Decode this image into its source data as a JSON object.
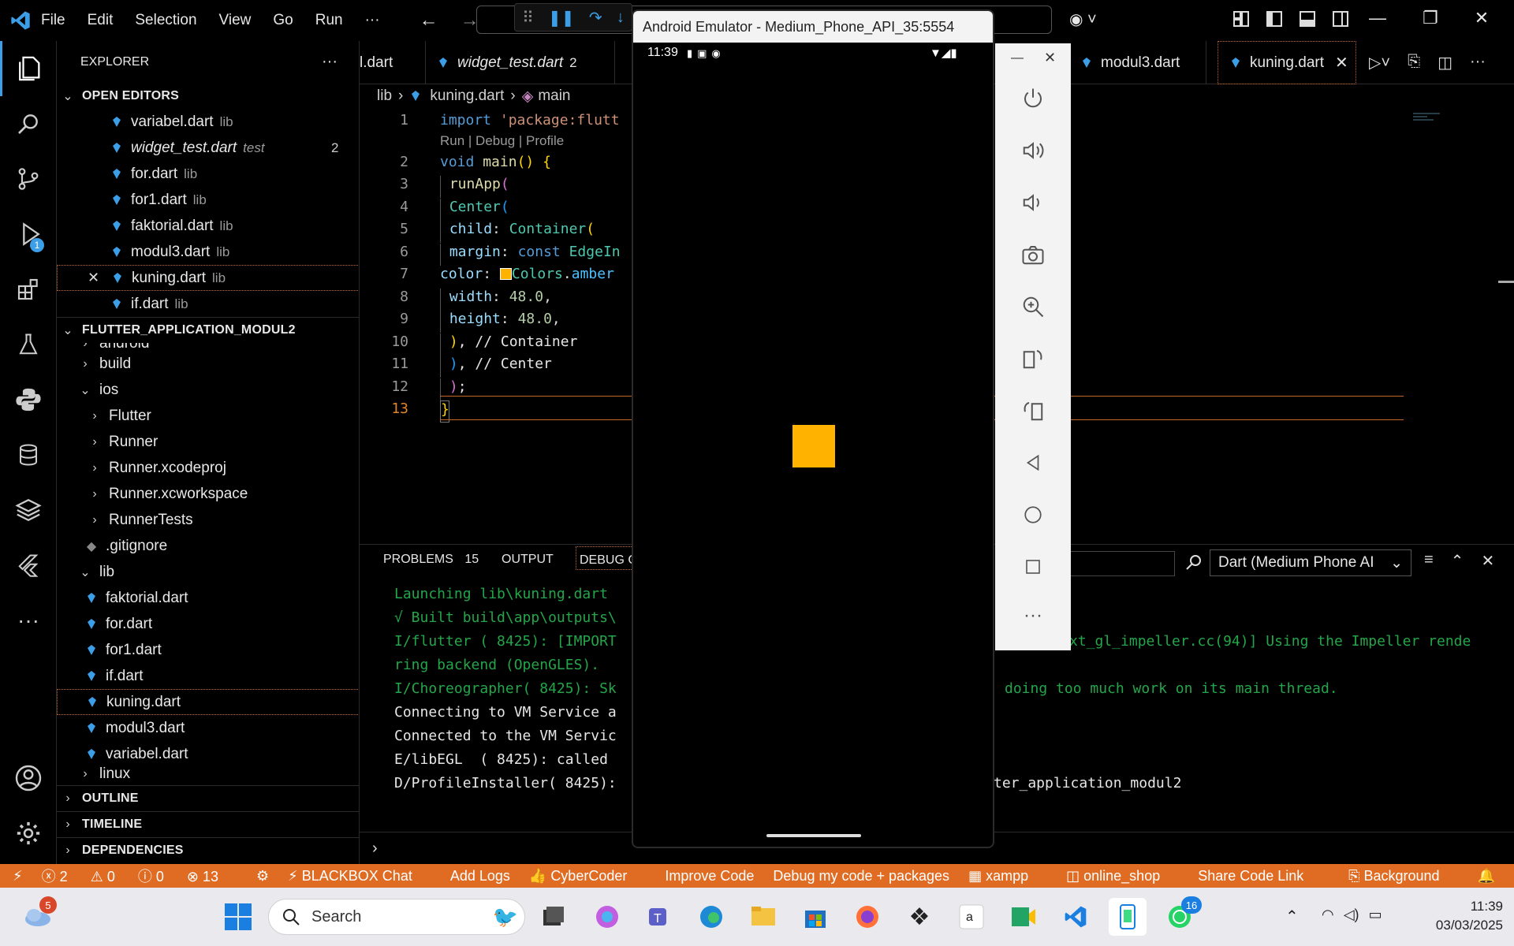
{
  "menu": [
    "File",
    "Edit",
    "Selection",
    "View",
    "Go",
    "Run",
    "···"
  ],
  "emulator": {
    "title": "Android Emulator - Medium_Phone_API_35:5554",
    "time": "11:39",
    "square_color": "#ffb300"
  },
  "explorer": {
    "title": "EXPLORER",
    "open_editors_label": "OPEN EDITORS",
    "open_editors": [
      {
        "name": "variabel.dart",
        "desc": "lib"
      },
      {
        "name": "widget_test.dart",
        "desc": "test",
        "badge": "2"
      },
      {
        "name": "for.dart",
        "desc": "lib"
      },
      {
        "name": "for1.dart",
        "desc": "lib"
      },
      {
        "name": "faktorial.dart",
        "desc": "lib"
      },
      {
        "name": "modul3.dart",
        "desc": "lib"
      },
      {
        "name": "kuning.dart",
        "desc": "lib"
      },
      {
        "name": "if.dart",
        "desc": "lib"
      }
    ],
    "project_label": "FLUTTER_APPLICATION_MODUL2",
    "tree": [
      "android",
      "build",
      "ios",
      "Flutter",
      "Runner",
      "Runner.xcodeproj",
      "Runner.xcworkspace",
      "RunnerTests",
      ".gitignore",
      "lib",
      "faktorial.dart",
      "for.dart",
      "for1.dart",
      "if.dart",
      "kuning.dart",
      "modul3.dart",
      "variabel.dart",
      "linux"
    ],
    "outline": "OUTLINE",
    "timeline": "TIMELINE",
    "dependencies": "DEPENDENCIES"
  },
  "tabs": [
    {
      "label": "l.dart"
    },
    {
      "label": "widget_test.dart",
      "badge": "2"
    },
    {
      "label": "modul3.dart"
    },
    {
      "label": "kuning.dart"
    }
  ],
  "breadcrumb": [
    "lib",
    "kuning.dart",
    "main"
  ],
  "codelens": "Run | Debug | Profile",
  "code": [
    {
      "n": "1",
      "t": "import 'package:flutt"
    },
    {
      "n": "2",
      "t": "void main() {"
    },
    {
      "n": "3",
      "t": " runApp("
    },
    {
      "n": "4",
      "t": " Center("
    },
    {
      "n": "5",
      "t": " child: Container("
    },
    {
      "n": "6",
      "t": " margin: const EdgeIn"
    },
    {
      "n": "7",
      "t": "color: Colors.amber"
    },
    {
      "n": "8",
      "t": " width: 48.0,"
    },
    {
      "n": "9",
      "t": " height: 48.0,"
    },
    {
      "n": "10",
      "t": " ), // Container"
    },
    {
      "n": "11",
      "t": " ), // Center"
    },
    {
      "n": "12",
      "t": " );"
    },
    {
      "n": "13",
      "t": "}"
    }
  ],
  "panel": {
    "problems": "PROBLEMS",
    "problems_count": "15",
    "output": "OUTPUT",
    "debug": "DEBUG C",
    "dropdown": "Dart (Medium Phone AI",
    "lines": [
      "Launching lib\\kuning.dart",
      "√ Built build\\app\\outputs\\",
      "I/flutter ( 8425): [IMPORT",
      "ring backend (OpenGLES).",
      "I/Choreographer( 8425): Sk",
      "Connecting to VM Service a",
      "Connected to the VM Servic",
      "E/libEGL  ( 8425): called",
      "D/ProfileInstaller( 8425):"
    ],
    "right_lines": [
      "xt_gl_impeller.cc(94)] Using the Impeller rende",
      "doing too much work on its main thread.",
      "ter_application_modul2"
    ]
  },
  "status": {
    "errors": "2",
    "warnings": "0",
    "info": "0",
    "other": "13",
    "items": [
      "BLACKBOX Chat",
      "Add Logs",
      "CyberCoder",
      "Improve Code",
      "Debug my code + packages",
      "xampp",
      "online_shop",
      "Share Code Link"
    ],
    "background": "Background"
  },
  "taskbar": {
    "search": "Search",
    "weather_badge": "5",
    "whatsapp_badge": "16",
    "time": "11:39",
    "date": "03/03/2025"
  },
  "activity_badge": "1"
}
